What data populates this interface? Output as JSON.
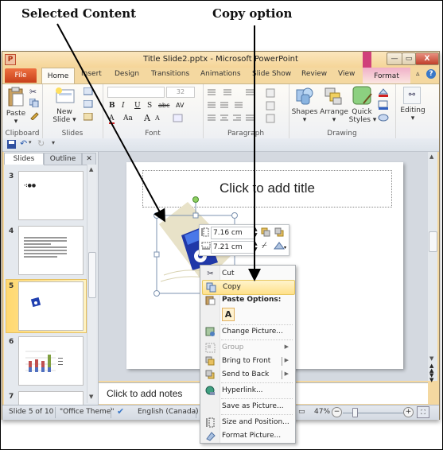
{
  "annotations": {
    "selected_content": "Selected Content",
    "copy_option": "Copy option"
  },
  "window": {
    "title": "Title Slide2.pptx - Microsoft PowerPoint",
    "app_icon_letter": "P",
    "controls": {
      "minimize": "—",
      "restore": "▭",
      "close": "X"
    }
  },
  "ribbon_tabs": {
    "file": "File",
    "home": "Home",
    "insert": "Insert",
    "design": "Design",
    "transitions": "Transitions",
    "animations": "Animations",
    "slide_show": "Slide Show",
    "review": "Review",
    "view": "View",
    "format": "Format"
  },
  "ribbon": {
    "clipboard": {
      "label": "Clipboard",
      "paste": "Paste"
    },
    "slides": {
      "label": "Slides",
      "new_slide_line1": "New",
      "new_slide_line2": "Slide ▾"
    },
    "font": {
      "label": "Font",
      "size": "32",
      "bold": "B",
      "italic": "I",
      "underline": "U",
      "shadow": "S",
      "strike": "abc",
      "spacing": "AV",
      "color": "A",
      "case": "Aa",
      "grow": "A",
      "shrink": "A"
    },
    "paragraph": {
      "label": "Paragraph"
    },
    "drawing": {
      "label": "Drawing",
      "shapes": "Shapes",
      "arrange": "Arrange",
      "quick_styles_line1": "Quick",
      "quick_styles_line2": "Styles ▾"
    },
    "editing": {
      "label": "Editing"
    }
  },
  "slides_pane": {
    "tabs": {
      "slides": "Slides",
      "outline": "Outline",
      "close": "✕"
    },
    "thumbnails": [
      {
        "number": "3",
        "selected": false
      },
      {
        "number": "4",
        "selected": false
      },
      {
        "number": "5",
        "selected": true
      },
      {
        "number": "6",
        "selected": false
      },
      {
        "number": "7",
        "selected": false
      }
    ]
  },
  "slide": {
    "title_placeholder": "Click to add title",
    "notes_placeholder": "Click to add notes"
  },
  "mini_toolbar": {
    "height_value": "7.16 cm",
    "width_value": "7.21 cm"
  },
  "context_menu": {
    "items": [
      {
        "label": "Cut",
        "icon": "scissors-icon"
      },
      {
        "label": "Copy",
        "icon": "copy-icon",
        "highlighted": true
      },
      {
        "label": "Paste Options:",
        "icon": "paste-icon",
        "header": true
      },
      {
        "label": "A",
        "icon": "paste-keep-text-icon"
      },
      {
        "label": "Change Picture...",
        "icon": "change-picture-icon"
      },
      {
        "label": "Group",
        "icon": "group-icon",
        "disabled": true,
        "submenu": true
      },
      {
        "label": "Bring to Front",
        "icon": "bring-front-icon",
        "submenu": true
      },
      {
        "label": "Send to Back",
        "icon": "send-back-icon",
        "submenu": true
      },
      {
        "label": "Hyperlink...",
        "icon": "hyperlink-icon"
      },
      {
        "label": "Save as Picture...",
        "icon": ""
      },
      {
        "label": "Size and Position...",
        "icon": "size-position-icon"
      },
      {
        "label": "Format Picture...",
        "icon": "format-picture-icon"
      }
    ]
  },
  "status_bar": {
    "slide_info": "Slide 5 of 10",
    "theme": "\"Office Theme\"",
    "language": "English (Canada)",
    "zoom": "47%"
  },
  "colors": {
    "file_tab": "#d0501f",
    "window_frame": "#f4d8a0",
    "menu_highlight": "#ffe08a",
    "format_tab": "#d0407a"
  }
}
